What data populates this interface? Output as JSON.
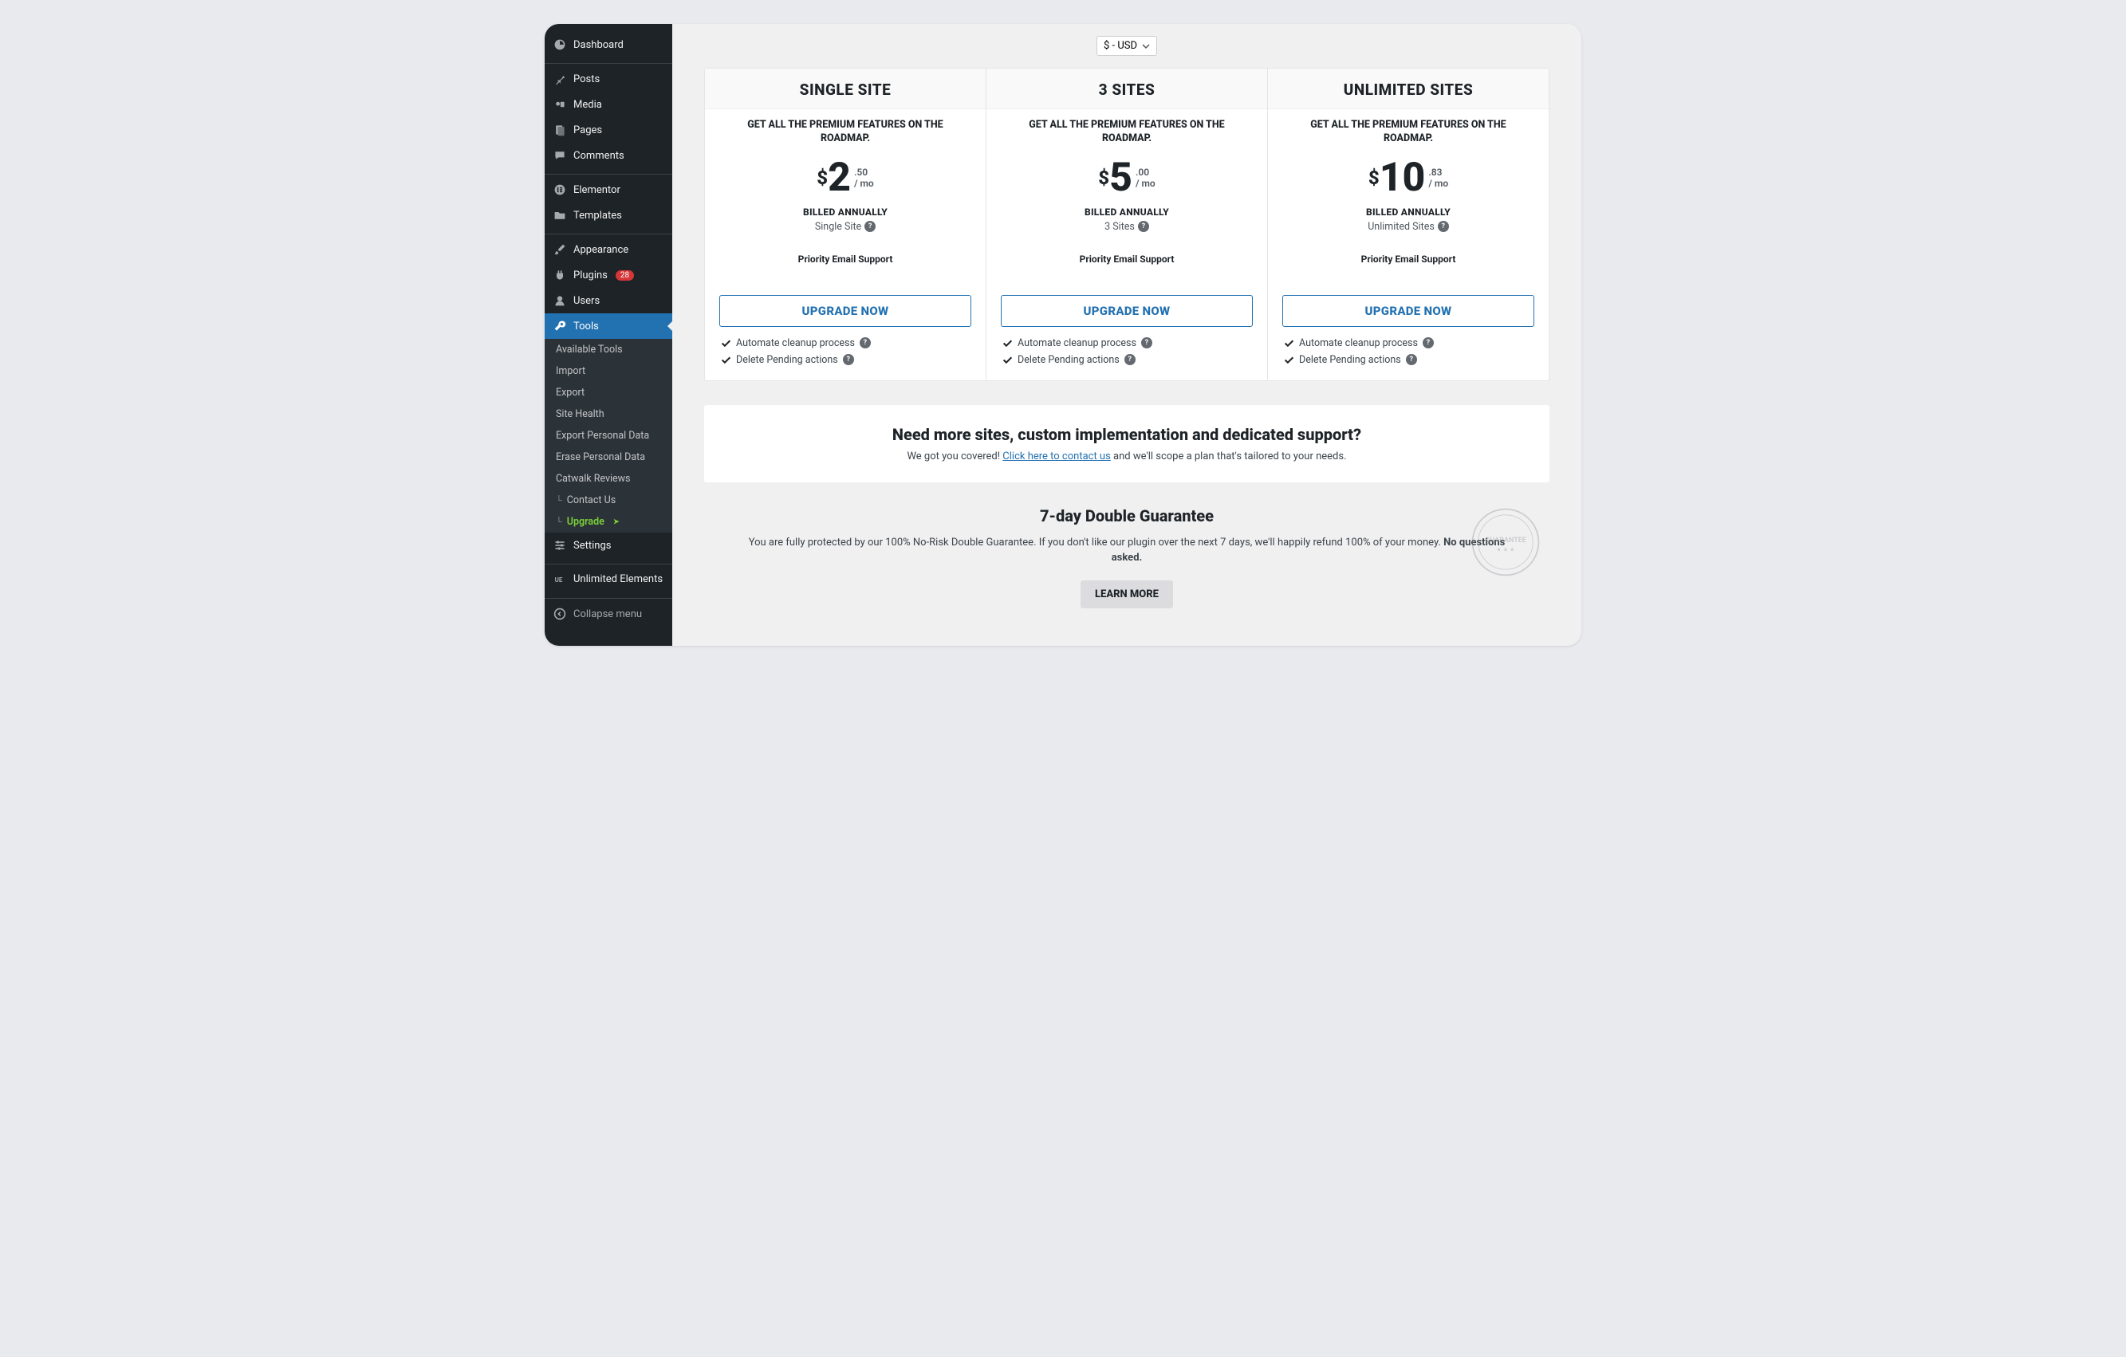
{
  "sidebar": {
    "dashboard": "Dashboard",
    "posts": "Posts",
    "media": "Media",
    "pages": "Pages",
    "comments": "Comments",
    "elementor": "Elementor",
    "templates": "Templates",
    "appearance": "Appearance",
    "plugins": "Plugins",
    "plugins_badge": "28",
    "users": "Users",
    "tools": "Tools",
    "sub": {
      "available": "Available Tools",
      "import": "Import",
      "export": "Export",
      "health": "Site Health",
      "epd": "Export Personal Data",
      "erd": "Erase Personal Data",
      "catwalk": "Catwalk Reviews",
      "contact": "Contact Us",
      "upgrade": "Upgrade",
      "upgrade_arrow": "➤"
    },
    "settings": "Settings",
    "unlimited": "Unlimited Elements",
    "collapse": "Collapse menu"
  },
  "currency_label": "$ - USD",
  "tagline": "GET ALL THE PREMIUM FEATURES ON THE ROADMAP.",
  "billed": "BILLED ANNUALLY",
  "support": "Priority Email Support",
  "upgrade_cta": "UPGRADE NOW",
  "per": "/ mo",
  "plans": [
    {
      "title": "SINGLE SITE",
      "cur": "$",
      "main": "2",
      "dec": ".50",
      "site": "Single Site"
    },
    {
      "title": "3 SITES",
      "cur": "$",
      "main": "5",
      "dec": ".00",
      "site": "3 Sites"
    },
    {
      "title": "UNLIMITED SITES",
      "cur": "$",
      "main": "10",
      "dec": ".83",
      "site": "Unlimited Sites"
    }
  ],
  "feat1": "Automate cleanup process",
  "feat2": "Delete Pending actions",
  "contact": {
    "title": "Need more sites, custom implementation and dedicated support?",
    "pre": "We got you covered! ",
    "link": "Click here to contact us",
    "post": " and we'll scope a plan that's tailored to your needs."
  },
  "guarantee": {
    "title": "7-day Double Guarantee",
    "text": "You are fully protected by our 100% No-Risk Double Guarantee. If you don't like our plugin over the next 7 days, we'll happily refund 100% of your money. ",
    "bold": "No questions asked.",
    "learn": "LEARN MORE",
    "stamp": "GUARANTEE"
  }
}
